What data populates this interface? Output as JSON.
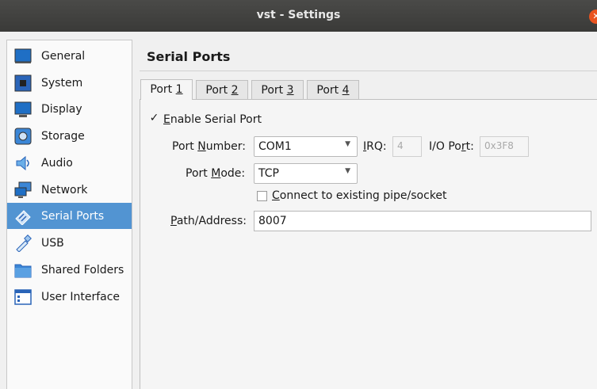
{
  "window": {
    "title": "vst - Settings",
    "close_glyph": "✕"
  },
  "sidebar": {
    "items": [
      {
        "label": "General",
        "icon": "general-icon"
      },
      {
        "label": "System",
        "icon": "system-icon"
      },
      {
        "label": "Display",
        "icon": "display-icon"
      },
      {
        "label": "Storage",
        "icon": "storage-icon"
      },
      {
        "label": "Audio",
        "icon": "audio-icon"
      },
      {
        "label": "Network",
        "icon": "network-icon"
      },
      {
        "label": "Serial Ports",
        "icon": "serial-ports-icon",
        "selected": true
      },
      {
        "label": "USB",
        "icon": "usb-icon"
      },
      {
        "label": "Shared Folders",
        "icon": "shared-folders-icon"
      },
      {
        "label": "User Interface",
        "icon": "user-interface-icon"
      }
    ],
    "selected_color": "#5294d2"
  },
  "page": {
    "heading": "Serial Ports"
  },
  "tabs": [
    {
      "pre": "Port ",
      "key": "1",
      "active": true
    },
    {
      "pre": "Port ",
      "key": "2"
    },
    {
      "pre": "Port ",
      "key": "3"
    },
    {
      "pre": "Port ",
      "key": "4"
    }
  ],
  "form": {
    "enable": {
      "pre": "",
      "key": "E",
      "post": "nable Serial Port",
      "checked": true,
      "mark": "✓"
    },
    "port_number": {
      "pre": "Port ",
      "key": "N",
      "post": "umber:",
      "value": "COM1"
    },
    "irq": {
      "pre": "",
      "key": "I",
      "post": "RQ:",
      "value": "4"
    },
    "io_port": {
      "pre": "I/O Po",
      "key": "r",
      "post": "t:",
      "value": "0x3F8"
    },
    "port_mode": {
      "pre": "Port ",
      "key": "M",
      "post": "ode:",
      "value": "TCP"
    },
    "connect": {
      "pre": "",
      "key": "C",
      "post": "onnect to existing pipe/socket",
      "checked": false
    },
    "path": {
      "pre": "",
      "key": "P",
      "post": "ath/Address:",
      "value": "8007"
    },
    "dropdown_arrow": "▼"
  }
}
